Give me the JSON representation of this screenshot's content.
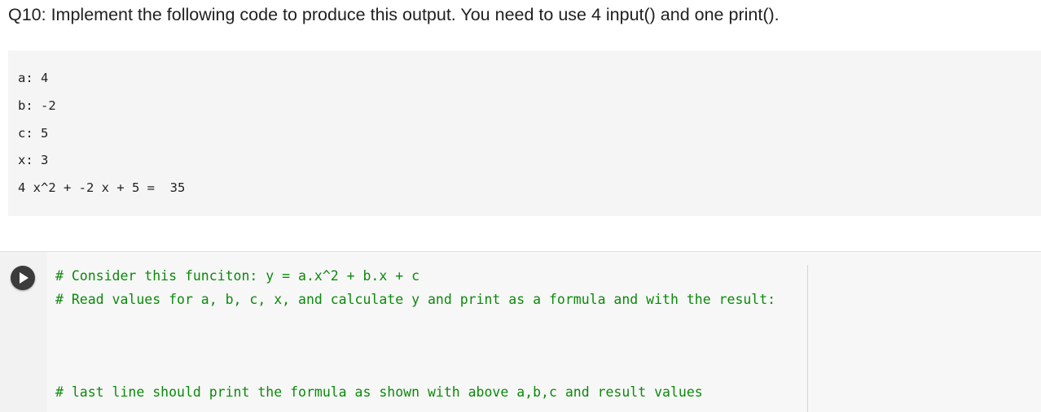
{
  "question": "Q10: Implement the following code to produce this output. You need to use 4 input() and one print().",
  "output": {
    "lines": [
      "a: 4",
      "b: -2",
      "c: 5",
      "x: 3",
      "4 x^2 + -2 x + 5 =  35"
    ]
  },
  "cell": {
    "run_icon": "play-icon",
    "code_lines": [
      "# Consider this funciton: y = a.x^2 + b.x + c",
      "# Read values for a, b, c, x, and calculate y and print as a formula and with the result:",
      "",
      "",
      "",
      "# last line should print the formula as shown with above a,b,c and result values"
    ]
  },
  "colors": {
    "comment": "#0b8a0b",
    "output_bg": "#f5f5f5",
    "run_button": "#3b3b3b"
  }
}
